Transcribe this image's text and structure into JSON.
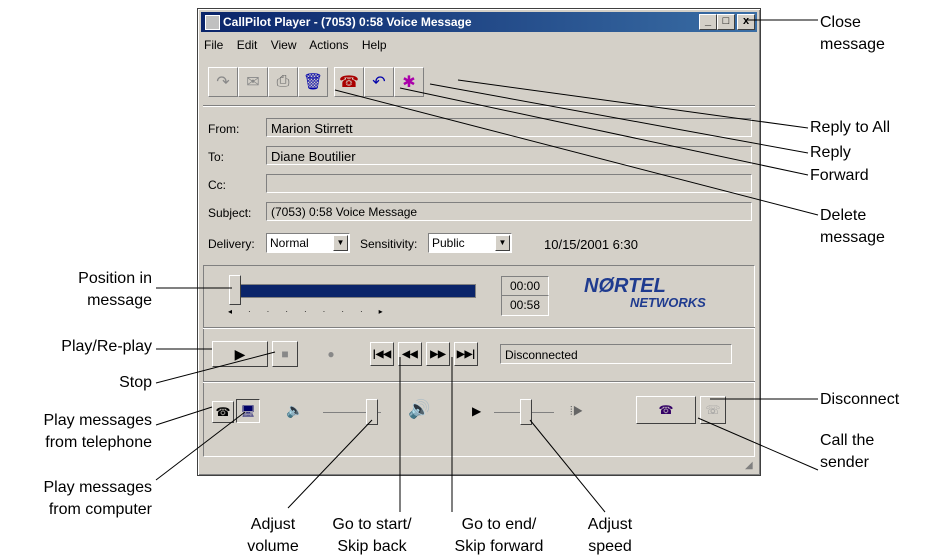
{
  "window": {
    "title": "CallPilot Player - (7053) 0:58 Voice Message",
    "caption_buttons": [
      "_",
      "□",
      "x"
    ]
  },
  "menu": [
    "File",
    "Edit",
    "View",
    "Actions",
    "Help"
  ],
  "toolbar_icons": [
    "reply-all-icon",
    "forward-icon",
    "print-icon",
    "delete-icon",
    "call-icon",
    "reply-icon",
    "reply-to-all-icon"
  ],
  "header": {
    "from_label": "From:",
    "from_value": "Marion Stirrett",
    "to_label": "To:",
    "to_value": "Diane Boutilier",
    "cc_label": "Cc:",
    "cc_value": "",
    "subject_label": "Subject:",
    "subject_value": "(7053) 0:58 Voice Message"
  },
  "options": {
    "delivery_label": "Delivery:",
    "delivery_value": "Normal",
    "sensitivity_label": "Sensitivity:",
    "sensitivity_value": "Public",
    "date": "10/15/2001 6:30"
  },
  "player": {
    "position_time": "00:00",
    "total_time": "00:58",
    "position_fraction": 0.0,
    "status": "Disconnected",
    "logo_line1": "NØRTEL",
    "logo_line2": "NETWORKS"
  },
  "callouts": {
    "close": "Close\nmessage",
    "reply_all": "Reply to All",
    "reply": "Reply",
    "forward": "Forward",
    "delete": "Delete\nmessage",
    "position": "Position in\nmessage",
    "play": "Play/Re-play",
    "stop": "Stop",
    "play_tel": "Play messages\nfrom telephone",
    "play_comp": "Play messages\nfrom computer",
    "disconnect": "Disconnect",
    "call_sender": "Call the\nsender",
    "adjust_volume": "Adjust\nvolume",
    "go_start": "Go to start/\nSkip back",
    "go_end": "Go to end/\nSkip forward",
    "adjust_speed": "Adjust\nspeed"
  }
}
